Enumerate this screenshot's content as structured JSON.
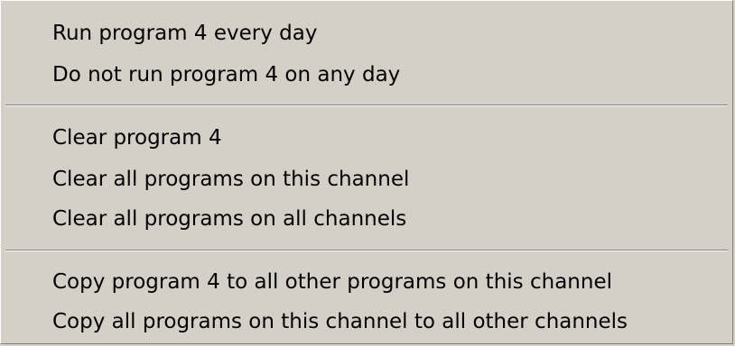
{
  "menu": {
    "groups": [
      {
        "items": [
          {
            "label": "Run program 4 every day"
          },
          {
            "label": "Do not run program 4 on any day"
          }
        ]
      },
      {
        "items": [
          {
            "label": "Clear program 4"
          },
          {
            "label": "Clear all programs on this channel"
          },
          {
            "label": "Clear all programs on all channels"
          }
        ]
      },
      {
        "items": [
          {
            "label": "Copy program 4 to all other programs on this channel"
          },
          {
            "label": "Copy all programs on this channel to all other channels"
          }
        ]
      }
    ]
  },
  "colors": {
    "menu_background": "#d4d0c8",
    "separator_dark": "#808080",
    "separator_light": "#ffffff",
    "text": "#000000"
  }
}
